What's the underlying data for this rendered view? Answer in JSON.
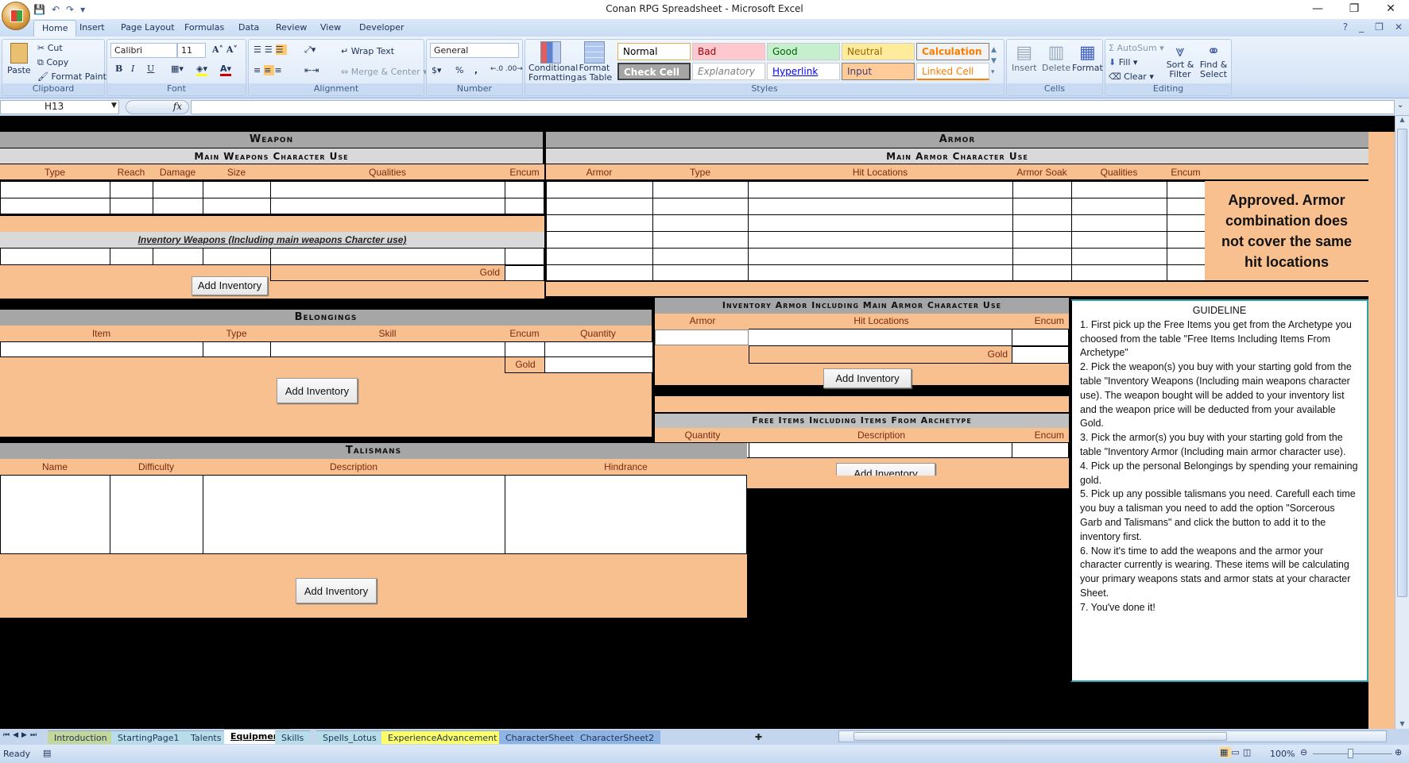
{
  "window": {
    "title": "Conan RPG Spreadsheet - Microsoft Excel",
    "minimize": "—",
    "restore": "❐",
    "close": "✕"
  },
  "qat": {
    "save": "💾",
    "undo": "↶",
    "redo": "↷",
    "customize": "▾"
  },
  "ribbon_tabs": [
    "Home",
    "Insert",
    "Page Layout",
    "Formulas",
    "Data",
    "Review",
    "View",
    "Developer"
  ],
  "active_tab": "Home",
  "clipboard": {
    "paste": "Paste",
    "cut": "Cut",
    "copy": "Copy",
    "format_painter": "Format Painter",
    "label": "Clipboard"
  },
  "font": {
    "name": "Calibri",
    "size": "11",
    "bold": "B",
    "italic": "I",
    "underline": "U",
    "label": "Font"
  },
  "alignment": {
    "wrap_text": "Wrap Text",
    "merge_center": "Merge & Center",
    "label": "Alignment"
  },
  "number": {
    "format": "General",
    "percent": "%",
    "comma": ",",
    "label": "Number"
  },
  "styles": {
    "conditional": "Conditional Formatting",
    "format_table": "Format as Table",
    "label": "Styles",
    "cells": [
      {
        "label": "Normal",
        "bg": "#ffffff",
        "color": "#000000"
      },
      {
        "label": "Bad",
        "bg": "#ffc7ce",
        "color": "#9c0006"
      },
      {
        "label": "Good",
        "bg": "#c6efce",
        "color": "#006100"
      },
      {
        "label": "Neutral",
        "bg": "#ffeb9c",
        "color": "#9c6500"
      },
      {
        "label": "Calculation",
        "bg": "#f2f2f2",
        "color": "#fa7d00"
      },
      {
        "label": "Check Cell",
        "bg": "#a5a5a5",
        "color": "#ffffff"
      },
      {
        "label": "Explanatory ...",
        "bg": "#ffffff",
        "color": "#7f7f7f"
      },
      {
        "label": "Hyperlink",
        "bg": "#ffffff",
        "color": "#0000ff"
      },
      {
        "label": "Input",
        "bg": "#ffcc99",
        "color": "#3f3f76"
      },
      {
        "label": "Linked Cell",
        "bg": "#ffffff",
        "color": "#fa7d00"
      }
    ]
  },
  "cells_group": {
    "insert": "Insert",
    "delete": "Delete",
    "format": "Format",
    "label": "Cells"
  },
  "editing": {
    "autosum": "AutoSum",
    "fill": "Fill",
    "clear": "Clear",
    "sort_filter": "Sort & Filter",
    "find_select": "Find & Select",
    "label": "Editing"
  },
  "formula_bar": {
    "name_box": "H13",
    "fx": "fx",
    "formula": ""
  },
  "weapon": {
    "title": "Weapon",
    "main_title": "Main Weapons Character Use",
    "columns": [
      "Type",
      "Reach",
      "Damage",
      "Size",
      "Qualities",
      "Encum"
    ],
    "inventory_title": "Inventory Weapons (Including main weapons Charcter use)",
    "gold_label": "Gold",
    "add_button": "Add Inventory"
  },
  "armor": {
    "title": "Armor",
    "main_title": "Main Armor Character Use",
    "columns": [
      "Armor",
      "Type",
      "Hit Locations",
      "Armor Soak",
      "Qualities",
      "Encum"
    ],
    "approval": "Approved. Armor combination does not cover the same hit locations"
  },
  "inventory_armor": {
    "title": "Inventory Armor  Including Main Armor Character Use",
    "columns": [
      "Armor",
      "Hit Locations",
      "Encum"
    ],
    "gold_label": "Gold",
    "add_button": "Add Inventory"
  },
  "belongings": {
    "title": "Belongings",
    "columns": [
      "Item",
      "Type",
      "Skill",
      "Encum",
      "Quantity"
    ],
    "gold_label": "Gold",
    "add_button": "Add Inventory"
  },
  "free_items": {
    "title": "Free Items  Including Items From Archetype",
    "columns": [
      "Quantity",
      "Description",
      "Encum"
    ],
    "add_button": "Add Inventory"
  },
  "talismans": {
    "title": "Talismans",
    "columns": [
      "Name",
      "Difficulty",
      "Description",
      "Hindrance"
    ],
    "add_button": "Add Inventory"
  },
  "guideline": {
    "title": "GUIDELINE",
    "steps": [
      "1. First pick up the Free Items you get from the Archetype you choosed from the table \"Free Items Including Items From Archetype\"",
      "2. Pick the weapon(s) you buy with your starting gold from the table \"Inventory Weapons (Including main weapons character use). The weapon bought will be added to your inventory list and the weapon price will be deducted from your available Gold.",
      "3. Pick the armor(s) you buy with your starting gold from the table \"Inventory Armor (Including main armor character use).",
      "4. Pick up the personal Belongings by spending your remaining gold.",
      "5. Pick up any possible talismans you need. Carefull each time you buy a talisman you need to add the option \"Sorcerous Garb and Talismans\" and click the button to add it to the inventory first.",
      "6. Now it's time to add the weapons and the armor your character currently is wearing. These items will be calculating your primary weapons stats and armor stats at your character Sheet.",
      "7. You've done it!"
    ]
  },
  "sheet_tabs": [
    {
      "label": "Introduction",
      "color": "#c4d79b"
    },
    {
      "label": "StartingPage1",
      "color": "#b7dee8"
    },
    {
      "label": "Talents",
      "color": "#b7dee8"
    },
    {
      "label": "Equipment",
      "color": "#ffffff"
    },
    {
      "label": "Skills",
      "color": "#b7dee8"
    },
    {
      "label": "Spells_Lotus",
      "color": "#b7dee8"
    },
    {
      "label": "ExperienceAdvancement",
      "color": "#ffff66"
    },
    {
      "label": "CharacterSheet",
      "color": "#8db4e2"
    },
    {
      "label": "CharacterSheet2",
      "color": "#8db4e2"
    }
  ],
  "active_sheet": "Equipment",
  "status": {
    "ready": "Ready",
    "zoom": "100%"
  }
}
